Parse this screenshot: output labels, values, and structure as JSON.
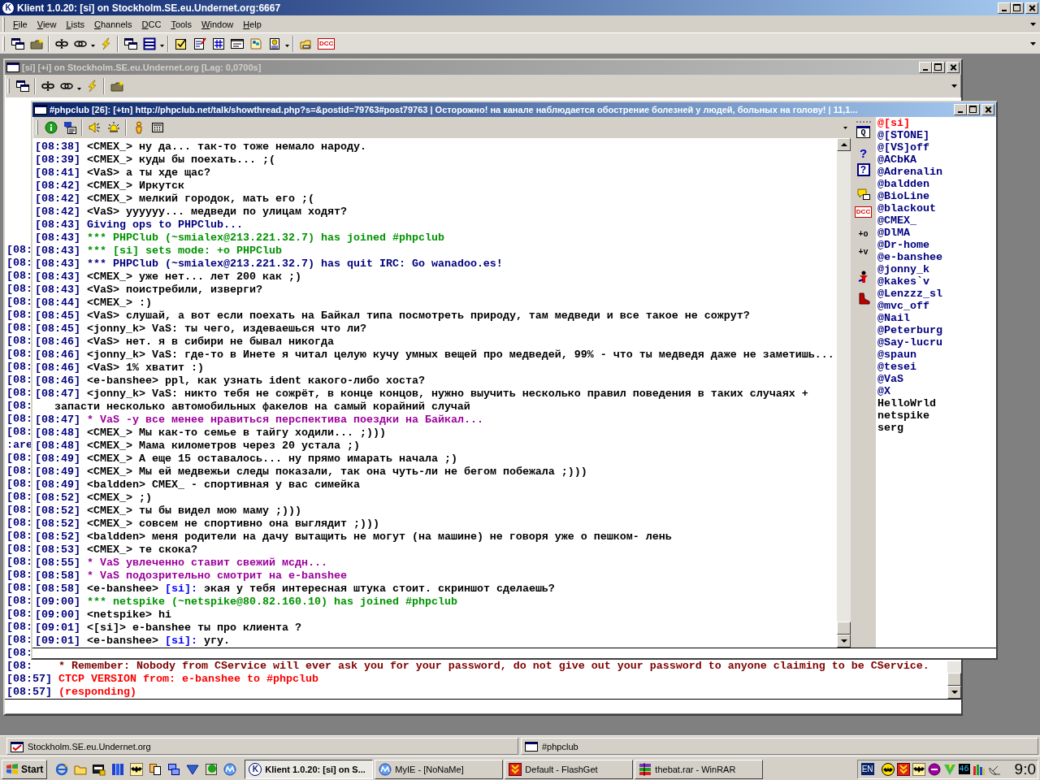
{
  "app": {
    "title": "Klient 1.0.20: [si] on Stockholm.SE.eu.Undernet.org:6667",
    "icon_letter": "K",
    "active": true
  },
  "menu": [
    "File",
    "View",
    "Lists",
    "Channels",
    "DCC",
    "Tools",
    "Window",
    "Help"
  ],
  "toolbar": [
    {
      "kind": "windows"
    },
    {
      "kind": "folder-star"
    },
    {
      "kind": "separator"
    },
    {
      "kind": "broken-link"
    },
    {
      "kind": "link"
    },
    {
      "kind": "caret"
    },
    {
      "kind": "bolt"
    },
    {
      "kind": "separator"
    },
    {
      "kind": "windows"
    },
    {
      "kind": "list"
    },
    {
      "kind": "caret"
    },
    {
      "kind": "separator"
    },
    {
      "kind": "checklist"
    },
    {
      "kind": "notepad"
    },
    {
      "kind": "grid"
    },
    {
      "kind": "card"
    },
    {
      "kind": "notes"
    },
    {
      "kind": "document"
    },
    {
      "kind": "caret"
    },
    {
      "kind": "separator"
    },
    {
      "kind": "folder-hand"
    },
    {
      "kind": "dcc",
      "label": "DCC"
    }
  ],
  "server_window": {
    "title": "[si] [+i] on Stockholm.SE.eu.Undernet.org [Lag: 0,0700s]",
    "active": false,
    "toolbar": [
      {
        "kind": "windows"
      },
      {
        "kind": "separator"
      },
      {
        "kind": "broken-link"
      },
      {
        "kind": "link"
      },
      {
        "kind": "caret"
      },
      {
        "kind": "bolt"
      },
      {
        "kind": "separator"
      },
      {
        "kind": "folder-star"
      }
    ],
    "log": [
      {
        "kind": "clipped",
        "text": "[08:"
      },
      {
        "kind": "clipped",
        "text": "[08:"
      },
      {
        "kind": "clipped",
        "text": "[08:"
      },
      {
        "kind": "clipped",
        "text": "[08:"
      },
      {
        "kind": "clipped",
        "text": "[08:"
      },
      {
        "kind": "clipped",
        "text": "[08:"
      },
      {
        "kind": "clipped",
        "text": "[08:"
      },
      {
        "kind": "clipped",
        "text": "[08:"
      },
      {
        "kind": "clipped",
        "text": "[08:"
      },
      {
        "kind": "clipped",
        "text": "[08:"
      },
      {
        "kind": "clipped",
        "text": "[08:"
      },
      {
        "kind": "clipped",
        "text": "[08:"
      },
      {
        "kind": "clipped",
        "text": "[08:"
      },
      {
        "kind": "clipped",
        "text": "[08:"
      },
      {
        "kind": "clipped",
        "text": "[08:"
      },
      {
        "kind": "clipped",
        "text": ":are"
      },
      {
        "kind": "clipped",
        "text": "[08:"
      },
      {
        "kind": "clipped",
        "text": "[08:"
      },
      {
        "kind": "clipped",
        "text": "[08:"
      },
      {
        "kind": "clipped",
        "text": "[08:"
      },
      {
        "kind": "clipped",
        "text": "[08:"
      },
      {
        "kind": "clipped",
        "text": "[08:"
      },
      {
        "kind": "clipped",
        "text": "[08:"
      },
      {
        "kind": "clipped",
        "text": "[08:"
      },
      {
        "kind": "clipped",
        "text": "[08:"
      },
      {
        "kind": "clipped",
        "text": "[08:"
      },
      {
        "kind": "clipped",
        "text": "[08:"
      },
      {
        "kind": "clipped",
        "text": "[08:"
      },
      {
        "kind": "clipped",
        "text": "[08:"
      },
      {
        "kind": "clipped",
        "text": "[08:"
      },
      {
        "kind": "clipped",
        "text": "[08:"
      },
      {
        "kind": "clipped",
        "text": "[08:"
      },
      {
        "kind": "service",
        "time": "[08:",
        "text": "* Remember: Nobody from CService will ever ask you for your password, do not give out your password to anyone claiming to be CService."
      },
      {
        "kind": "ctcp",
        "time": "[08:57]",
        "text": "CTCP VERSION from: e-banshee to #phpclub"
      },
      {
        "kind": "ctcp",
        "time": "[08:57]",
        "text": "(responding)"
      }
    ]
  },
  "channel_window": {
    "title": "#phpclub [26]: [+tn] http://phpclub.net/talk/showthread.php?s=&postid=79763#post79763 | Осторожно! на канале наблюдается обострение болезней у людей, больных на голову! | 11,1...",
    "active": true,
    "toolbar": [
      {
        "kind": "info"
      },
      {
        "kind": "chat"
      },
      {
        "kind": "separator"
      },
      {
        "kind": "speaker"
      },
      {
        "kind": "bell"
      },
      {
        "kind": "separator"
      },
      {
        "kind": "person"
      },
      {
        "kind": "keypad"
      }
    ],
    "messages": [
      {
        "time": "[08:38]",
        "kind": "message",
        "nick": "<CMEX_>",
        "text": "ну да... так-то тоже немало народу."
      },
      {
        "time": "[08:39]",
        "kind": "message",
        "nick": "<CMEX_>",
        "text": "куды бы поехать... ;("
      },
      {
        "time": "[08:41]",
        "kind": "message",
        "nick": "<VaS>",
        "text": "а ты хде щас?"
      },
      {
        "time": "[08:42]",
        "kind": "message",
        "nick": "<CMEX_>",
        "text": "Иркутск"
      },
      {
        "time": "[08:42]",
        "kind": "message",
        "nick": "<CMEX_>",
        "text": "мелкий городок, мать его ;("
      },
      {
        "time": "[08:42]",
        "kind": "message",
        "nick": "<VaS>",
        "text": "уууууу... медведи по улицам ходят?"
      },
      {
        "time": "[08:43]",
        "kind": "notice",
        "text": "Giving ops to PHPClub..."
      },
      {
        "time": "[08:43]",
        "kind": "event",
        "text": "*** PHPClub (~smialex@213.221.32.7) has joined #phpclub"
      },
      {
        "time": "[08:43]",
        "kind": "event",
        "text": "*** [si] sets mode: +o PHPClub"
      },
      {
        "time": "[08:43]",
        "kind": "notice",
        "text": "*** PHPClub (~smialex@213.221.32.7) has quit IRC: Go wanadoo.es!"
      },
      {
        "time": "[08:43]",
        "kind": "message",
        "nick": "<CMEX_>",
        "text": "уже нет... лет 200 как ;)"
      },
      {
        "time": "[08:43]",
        "kind": "message",
        "nick": "<VaS>",
        "text": "поистребили, изверги?"
      },
      {
        "time": "[08:44]",
        "kind": "message",
        "nick": "<CMEX_>",
        "text": ":)"
      },
      {
        "time": "[08:45]",
        "kind": "message",
        "nick": "<VaS>",
        "text": "слушай, а вот если поехать на Байкал типа посмотреть природу, там медведи и все такое не сожрут?"
      },
      {
        "time": "[08:45]",
        "kind": "message",
        "nick": "<jonny_k>",
        "text": "VaS: ты чего, издеваешься что ли?"
      },
      {
        "time": "[08:46]",
        "kind": "message",
        "nick": "<VaS>",
        "text": "нет. я в сибири не бывал никогда"
      },
      {
        "time": "[08:46]",
        "kind": "message",
        "nick": "<jonny_k>",
        "text": "VaS: где-то в Инете я читал целую кучу умных вещей про медведей, 99% - что ты медведя даже не заметишь..."
      },
      {
        "time": "[08:46]",
        "kind": "message",
        "nick": "<VaS>",
        "text": "1% хватит :)"
      },
      {
        "time": "[08:46]",
        "kind": "message",
        "nick": "<e-banshee>",
        "text": "ppl, как узнать ident какого-либо хоста?"
      },
      {
        "time": "[08:47]",
        "kind": "message",
        "nick": "<jonny_k>",
        "text": "VaS: никто тебя не сожрёт, в конце концов, нужно выучить несколько правил поведения в таких случаях + запасти несколько автомобильных факелов на самый корайний случай"
      },
      {
        "time": "[08:47]",
        "kind": "action",
        "text": "* VaS -у все менее нравиться перспектива поездки на Байкал..."
      },
      {
        "time": "[08:48]",
        "kind": "message",
        "nick": "<CMEX_>",
        "text": "Мы как-то семье в тайгу ходили... ;)))"
      },
      {
        "time": "[08:48]",
        "kind": "message",
        "nick": "<CMEX_>",
        "text": "Мама километров через 20 устала ;)"
      },
      {
        "time": "[08:49]",
        "kind": "message",
        "nick": "<CMEX_>",
        "text": "А еще 15 оставалось... ну прямо имарать начала ;)"
      },
      {
        "time": "[08:49]",
        "kind": "message",
        "nick": "<CMEX_>",
        "text": "Мы ей медвежьи следы показали, так она чуть-ли не бегом побежала ;)))"
      },
      {
        "time": "[08:49]",
        "kind": "message",
        "nick": "<baldden>",
        "text": "CMEX_ - спортивная у вас симейка"
      },
      {
        "time": "[08:52]",
        "kind": "message",
        "nick": "<CMEX_>",
        "text": ";)"
      },
      {
        "time": "[08:52]",
        "kind": "message",
        "nick": "<CMEX_>",
        "text": "ты бы видел мою маму ;)))"
      },
      {
        "time": "[08:52]",
        "kind": "message",
        "nick": "<CMEX_>",
        "text": "совсем не спортивно она выглядит ;)))"
      },
      {
        "time": "[08:52]",
        "kind": "message",
        "nick": "<baldden>",
        "text": "меня родители на дачу вытащить не могут (на машине) не говоря уже о пешком- лень"
      },
      {
        "time": "[08:53]",
        "kind": "message",
        "nick": "<CMEX_>",
        "text": "те скока?"
      },
      {
        "time": "[08:55]",
        "kind": "action",
        "text": "* VaS увлеченно ставит свежий мсдн..."
      },
      {
        "time": "[08:58]",
        "kind": "action",
        "text": "* VaS подозрительно смотрит на e-banshee"
      },
      {
        "time": "[08:58]",
        "kind": "message",
        "nick": "<e-banshee>",
        "mention": "[si]:",
        "text": "экая у тебя интересная штука стоит. скриншот сделаешь?"
      },
      {
        "time": "[09:00]",
        "kind": "event",
        "text": "*** netspike (~netspike@80.82.160.10) has joined #phpclub"
      },
      {
        "time": "[09:00]",
        "kind": "message",
        "nick": "<netspike>",
        "text": "hi"
      },
      {
        "time": "[09:01]",
        "kind": "message",
        "nick": "<[si]>",
        "text": "e-banshee ты про клиента ?"
      },
      {
        "time": "[09:01]",
        "kind": "message",
        "nick": "<e-banshee>",
        "mention": "[si]:",
        "text": "угу."
      }
    ],
    "side_tools": [
      {
        "kind": "query",
        "label": "Q"
      },
      {
        "kind": "help",
        "label": "?"
      },
      {
        "kind": "help-box",
        "label": "?"
      },
      {
        "kind": "chat-yellow"
      },
      {
        "kind": "dcc",
        "label": "DCC"
      },
      {
        "kind": "op",
        "label": "+o"
      },
      {
        "kind": "voice",
        "label": "+v"
      },
      {
        "kind": "person-red"
      },
      {
        "kind": "kick"
      }
    ],
    "nicks": [
      {
        "nick": "@[si]",
        "color": "#ff0000"
      },
      {
        "nick": "@[STONE]",
        "color": "#00007f"
      },
      {
        "nick": "@[VS]off",
        "color": "#00007f"
      },
      {
        "nick": "@ACbKA",
        "color": "#00007f"
      },
      {
        "nick": "@Adrenalin",
        "color": "#00007f"
      },
      {
        "nick": "@baldden",
        "color": "#00007f"
      },
      {
        "nick": "@BioLine",
        "color": "#00007f"
      },
      {
        "nick": "@blackout",
        "color": "#00007f"
      },
      {
        "nick": "@CMEX_",
        "color": "#00007f"
      },
      {
        "nick": "@DlMA",
        "color": "#00007f"
      },
      {
        "nick": "@Dr-home",
        "color": "#00007f"
      },
      {
        "nick": "@e-banshee",
        "color": "#00007f"
      },
      {
        "nick": "@jonny_k",
        "color": "#00007f"
      },
      {
        "nick": "@kakes`v",
        "color": "#00007f"
      },
      {
        "nick": "@Lenzzz_sl",
        "color": "#00007f"
      },
      {
        "nick": "@mvc_off",
        "color": "#00007f"
      },
      {
        "nick": "@Nail",
        "color": "#00007f"
      },
      {
        "nick": "@Peterburg",
        "color": "#00007f"
      },
      {
        "nick": "@Say-lucru",
        "color": "#00007f"
      },
      {
        "nick": "@spaun",
        "color": "#00007f"
      },
      {
        "nick": "@tesei",
        "color": "#00007f"
      },
      {
        "nick": "@VaS",
        "color": "#00007f"
      },
      {
        "nick": "@X",
        "color": "#00007f"
      },
      {
        "nick": "HelloWrld",
        "color": "#000000"
      },
      {
        "nick": "netspike",
        "color": "#000000"
      },
      {
        "nick": "serg",
        "color": "#000000"
      }
    ]
  },
  "window_list": [
    {
      "kind": "server",
      "label": "Stockholm.SE.eu.Undernet.org"
    },
    {
      "kind": "channel",
      "label": "#phpclub"
    }
  ],
  "taskbar": {
    "start": "Start",
    "quick_launch": [
      {
        "kind": "browser"
      },
      {
        "kind": "folder"
      },
      {
        "kind": "card-lock"
      },
      {
        "kind": "books"
      },
      {
        "kind": "bat"
      },
      {
        "kind": "copy"
      },
      {
        "kind": "network"
      },
      {
        "kind": "triangle"
      },
      {
        "kind": "globe-green"
      },
      {
        "kind": "m-globe"
      }
    ],
    "tasks": [
      {
        "kind": "klient",
        "icon_letter": "K",
        "label": "Klient 1.0.20: [si] on S...",
        "selected": true
      },
      {
        "kind": "m-globe",
        "label": "MyIE - [NoNaMe]",
        "selected": false
      },
      {
        "kind": "download",
        "label": "Default - FlashGet",
        "selected": false
      },
      {
        "kind": "winrar",
        "label": "thebat.rar - WinRAR",
        "selected": false
      }
    ],
    "tray": [
      {
        "kind": "language",
        "label": "EN"
      },
      {
        "kind": "bat-yellow"
      },
      {
        "kind": "download"
      },
      {
        "kind": "bat"
      },
      {
        "kind": "minus"
      },
      {
        "kind": "vee"
      },
      {
        "kind": "counter",
        "label": "46"
      },
      {
        "kind": "meter"
      },
      {
        "kind": "satellite"
      }
    ],
    "clock": "9:0"
  }
}
